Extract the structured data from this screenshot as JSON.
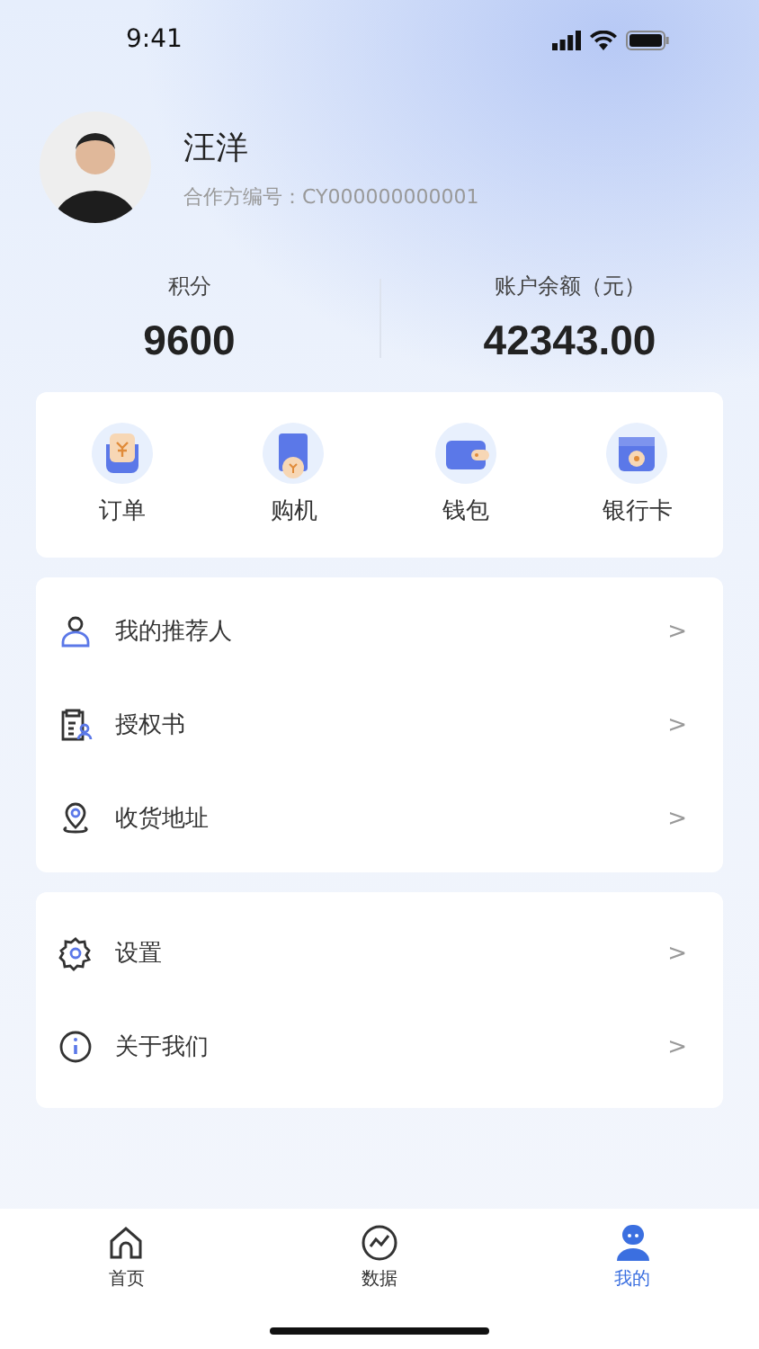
{
  "status_bar": {
    "time": "9:41"
  },
  "profile": {
    "name": "汪洋",
    "partner_id": "合作方编号：CY000000000001"
  },
  "stats": [
    {
      "label": "积分",
      "value": "9600"
    },
    {
      "label": "账户余额（元）",
      "value": "42343.00"
    }
  ],
  "shortcuts": [
    {
      "label": "订单"
    },
    {
      "label": "购机"
    },
    {
      "label": "钱包"
    },
    {
      "label": "银行卡"
    }
  ],
  "menu_groups": [
    [
      {
        "label": "我的推荐人",
        "chevron": ">"
      },
      {
        "label": "授权书",
        "chevron": ">"
      },
      {
        "label": "收货地址",
        "chevron": ">"
      }
    ],
    [
      {
        "label": "设置",
        "chevron": ">"
      },
      {
        "label": "关于我们",
        "chevron": ">"
      }
    ]
  ],
  "tab_bar": [
    {
      "label": "首页",
      "selected": false
    },
    {
      "label": "数据",
      "selected": false
    },
    {
      "label": "我的",
      "selected": true
    }
  ]
}
